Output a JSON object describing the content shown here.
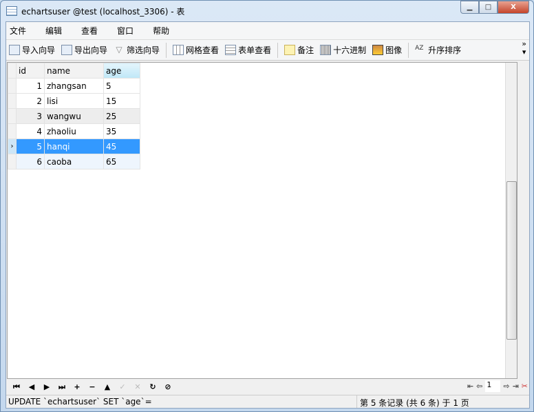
{
  "window": {
    "title": "echartsuser @test (localhost_3306) - 表",
    "minimize": "▁",
    "maximize": "□",
    "close": "X"
  },
  "menu": [
    "文件",
    "编辑",
    "查看",
    "窗口",
    "帮助"
  ],
  "toolbar": [
    {
      "label": "导入向导",
      "icon": "import-wizard-icon"
    },
    {
      "label": "导出向导",
      "icon": "export-wizard-icon"
    },
    {
      "label": "筛选向导",
      "icon": "filter-icon"
    },
    {
      "label": "网格查看",
      "icon": "grid-view-icon"
    },
    {
      "label": "表单查看",
      "icon": "form-view-icon"
    },
    {
      "label": "备注",
      "icon": "memo-icon"
    },
    {
      "label": "十六进制",
      "icon": "hex-icon"
    },
    {
      "label": "图像",
      "icon": "image-icon"
    },
    {
      "label": "升序排序",
      "icon": "sort-ascending-icon"
    }
  ],
  "toolbar_more": "»",
  "grid": {
    "columns": [
      "id",
      "name",
      "age"
    ],
    "rows": [
      {
        "id": "1",
        "name": "zhangsan",
        "age": "5"
      },
      {
        "id": "2",
        "name": "lisi",
        "age": "15"
      },
      {
        "id": "3",
        "name": "wangwu",
        "age": "25"
      },
      {
        "id": "4",
        "name": "zhaoliu",
        "age": "35"
      },
      {
        "id": "5",
        "name": "hanqi",
        "age": "45"
      },
      {
        "id": "6",
        "name": "caoba",
        "age": "65"
      }
    ],
    "selected_row": 5,
    "current_indicator": "›"
  },
  "nav": {
    "first": "⏮",
    "prev": "◀",
    "next": "▶",
    "last": "⏭",
    "add": "+",
    "delete": "−",
    "up": "▲",
    "apply": "✓",
    "cancel": "✕",
    "refresh": "↻",
    "stop": "⊘",
    "page": "1",
    "page_first": "⇤",
    "page_prev": "⇦",
    "page_next": "⇨",
    "page_last": "⇥",
    "settings": "✂"
  },
  "status": {
    "sql": "UPDATE `echartsuser` SET `age`=",
    "record": "第 5 条记录 (共 6 条) 于 1 页"
  }
}
